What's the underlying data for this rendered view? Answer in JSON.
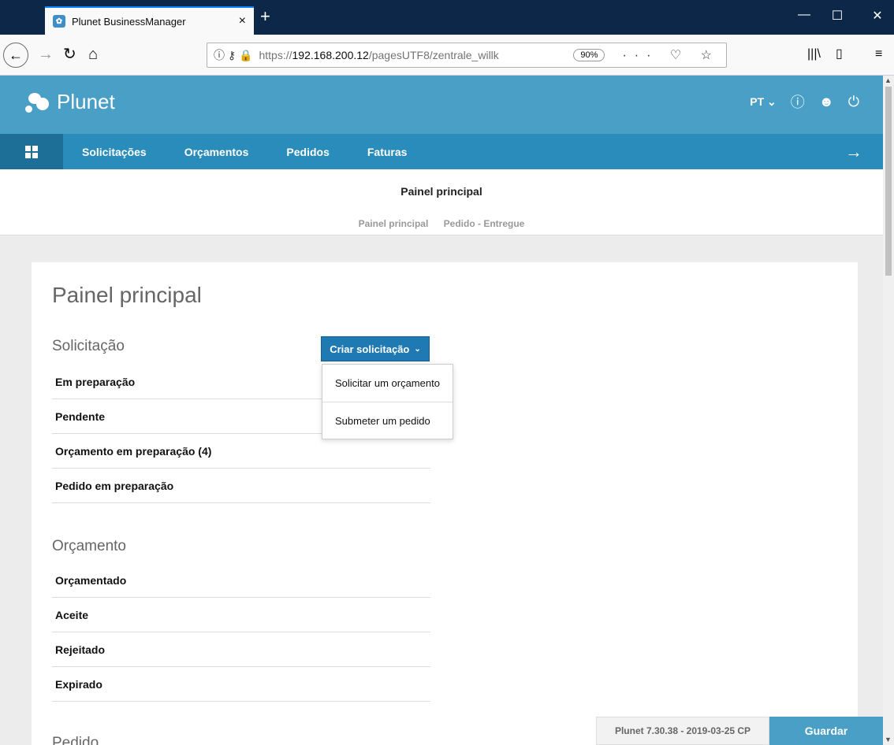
{
  "browser": {
    "tab_title": "Plunet BusinessManager",
    "tab_close": "×",
    "new_tab": "+",
    "url_protocol": "https://",
    "url_host": "192.168.200.12",
    "url_path": "/pagesUTF8/zentrale_willk",
    "zoom": "90%",
    "win_minimize": "—",
    "win_maximize": "☐",
    "win_close": "✕"
  },
  "app": {
    "logo_text": "Plunet",
    "language": "PT",
    "nav": [
      "Solicitações",
      "Orçamentos",
      "Pedidos",
      "Faturas"
    ],
    "band_title": "Painel principal",
    "breadcrumbs": [
      "Painel principal",
      "Pedido - Entregue"
    ]
  },
  "card": {
    "title": "Painel principal",
    "create_button": "Criar solicitação",
    "dropdown": [
      "Solicitar um orçamento",
      "Submeter um pedido"
    ],
    "sections": [
      {
        "title": "Solicitação",
        "items": [
          "Em preparação",
          "Pendente",
          "Orçamento em preparação (4)",
          "Pedido em preparação"
        ]
      },
      {
        "title": "Orçamento",
        "items": [
          "Orçamentado",
          "Aceite",
          "Rejeitado",
          "Expirado"
        ]
      },
      {
        "title": "Pedido",
        "items": []
      }
    ]
  },
  "footer": {
    "version": "Plunet 7.30.38 - 2019-03-25 CP",
    "save": "Guardar"
  },
  "colors": {
    "header": "#4a9fc7",
    "nav": "#2a8cba",
    "button": "#1f7ab3"
  }
}
